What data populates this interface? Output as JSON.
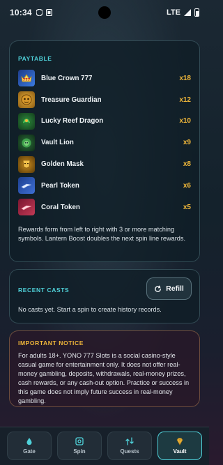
{
  "status_bar": {
    "time": "10:34",
    "network": "LTE"
  },
  "paytable": {
    "title": "PAYTABLE",
    "rows": [
      {
        "name": "Blue Crown 777",
        "multiplier": "x18",
        "icon": "blue-crown-777-icon"
      },
      {
        "name": "Treasure Guardian",
        "multiplier": "x12",
        "icon": "treasure-guardian-icon"
      },
      {
        "name": "Lucky Reef Dragon",
        "multiplier": "x10",
        "icon": "lucky-reef-dragon-icon"
      },
      {
        "name": "Vault Lion",
        "multiplier": "x9",
        "icon": "vault-lion-icon"
      },
      {
        "name": "Golden Mask",
        "multiplier": "x8",
        "icon": "golden-mask-icon"
      },
      {
        "name": "Pearl Token",
        "multiplier": "x6",
        "icon": "pearl-token-icon"
      },
      {
        "name": "Coral Token",
        "multiplier": "x5",
        "icon": "coral-token-icon"
      }
    ],
    "note": "Rewards form from left to right with 3 or more matching symbols. Lantern Boost doubles the next spin line rewards."
  },
  "recent_casts": {
    "title": "RECENT CASTS",
    "refill_label": "Refill",
    "empty_text": "No casts yet. Start a spin to create history records."
  },
  "notice": {
    "title": "IMPORTANT NOTICE",
    "text": "For adults 18+. YONO 777 Slots is a social casino-style casual game for entertainment only. It does not offer real-money gambling, deposits, withdrawals, real-money prizes, cash rewards, or any cash-out option. Practice or success in this game does not imply future success in real-money gambling."
  },
  "nav": {
    "items": [
      {
        "label": "Gate",
        "icon": "drop-icon"
      },
      {
        "label": "Spin",
        "icon": "spin-icon"
      },
      {
        "label": "Quests",
        "icon": "path-icon"
      },
      {
        "label": "Vault",
        "icon": "gem-icon",
        "active": true
      }
    ]
  },
  "colors": {
    "accent": "#4fd1d9",
    "multiplier": "#f0b73a",
    "notice_title": "#f0b73a"
  }
}
